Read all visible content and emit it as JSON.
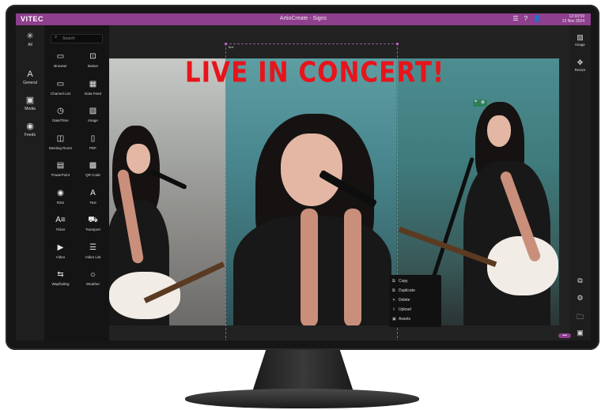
{
  "app": {
    "logo": "VITEC",
    "window_title": "ArtioCreate - Signs",
    "clock_time": "12:03:59",
    "clock_date": "13 Nov 2024"
  },
  "categories": [
    {
      "icon": "asterisk-icon",
      "label": "All"
    },
    {
      "icon": "text-a-icon",
      "label": "General"
    },
    {
      "icon": "media-icon",
      "label": "Media"
    },
    {
      "icon": "rss-icon",
      "label": "Feeds"
    }
  ],
  "search": {
    "placeholder": "Search"
  },
  "widgets": [
    {
      "icon": "browser-icon",
      "label": "Browser"
    },
    {
      "icon": "button-icon",
      "label": "Button"
    },
    {
      "icon": "channel-list-icon",
      "label": "Channel List"
    },
    {
      "icon": "data-feed-icon",
      "label": "Data Feed"
    },
    {
      "icon": "datetime-icon",
      "label": "Date/Time"
    },
    {
      "icon": "image-icon",
      "label": "Image"
    },
    {
      "icon": "meeting-room-icon",
      "label": "Meeting Room"
    },
    {
      "icon": "pdf-icon",
      "label": "PDF"
    },
    {
      "icon": "powerpoint-icon",
      "label": "PowerPoint"
    },
    {
      "icon": "qr-code-icon",
      "label": "QR Code"
    },
    {
      "icon": "rss-icon",
      "label": "RSS"
    },
    {
      "icon": "text-icon",
      "label": "Text"
    },
    {
      "icon": "ticker-icon",
      "label": "Ticker"
    },
    {
      "icon": "transport-icon",
      "label": "Transport"
    },
    {
      "icon": "video-icon",
      "label": "Video"
    },
    {
      "icon": "video-list-icon",
      "label": "Video List"
    },
    {
      "icon": "wayfinding-icon",
      "label": "Wayfinding"
    },
    {
      "icon": "weather-icon",
      "label": "Weather"
    }
  ],
  "canvas": {
    "headline": "LIVE IN CONCERT!",
    "headline_color": "#e8141b",
    "selection_label": "Text"
  },
  "context_menu": [
    {
      "icon": "copy-icon",
      "label": "Copy"
    },
    {
      "icon": "duplicate-icon",
      "label": "Duplicate"
    },
    {
      "icon": "delete-icon",
      "label": "Delete"
    },
    {
      "icon": "upload-icon",
      "label": "Upload"
    },
    {
      "icon": "assets-icon",
      "label": "Assets"
    }
  ],
  "right_tools": [
    {
      "icon": "image-icon",
      "label": "Image"
    },
    {
      "icon": "resize-icon",
      "label": "Resize"
    }
  ],
  "accent_color": "#8e3f8d"
}
